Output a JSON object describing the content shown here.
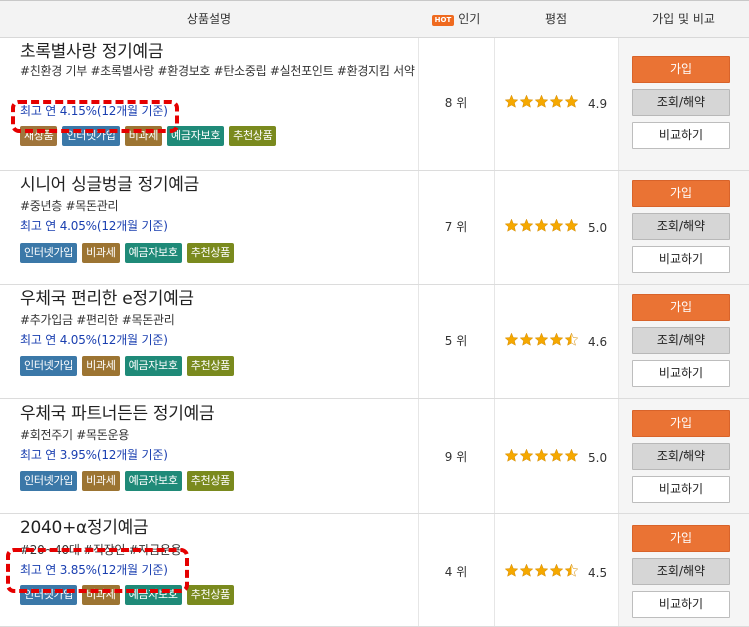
{
  "header": {
    "description": "상품설명",
    "hot": "HOT",
    "popularity": "인기",
    "rating": "평점",
    "actions": "가입 및 비교"
  },
  "colors": {
    "accent": "#ea7334",
    "rate_text": "#1a3fb0",
    "star": "#f5a800",
    "highlight": "#e50000"
  },
  "products": [
    {
      "name": "초록별사랑 정기예금",
      "tags": "#친환경 기부 #초록별사랑 #환경보호 #탄소중립 #실천포인트 #환경지킴 서약",
      "rate": "최고 연 4.15%(12개월 기준)",
      "badges": [
        "새상품",
        "인터넷가입",
        "비과세",
        "예금자보호",
        "추천상품"
      ],
      "rank": "8 위",
      "stars": 5,
      "score": "4.9",
      "join": "가입",
      "inquiry": "조회/해약",
      "compare": "비교하기"
    },
    {
      "name": "시니어 싱글벙글 정기예금",
      "tags": "#중년층 #목돈관리",
      "rate": "최고 연 4.05%(12개월 기준)",
      "badges": [
        "인터넷가입",
        "비과세",
        "예금자보호",
        "추천상품"
      ],
      "rank": "7 위",
      "stars": 5,
      "score": "5.0",
      "join": "가입",
      "inquiry": "조회/해약",
      "compare": "비교하기"
    },
    {
      "name": "우체국 편리한 e정기예금",
      "tags": "#추가입금 #편리한 #목돈관리",
      "rate": "최고 연 4.05%(12개월 기준)",
      "badges": [
        "인터넷가입",
        "비과세",
        "예금자보호",
        "추천상품"
      ],
      "rank": "5 위",
      "stars": 4.5,
      "score": "4.6",
      "join": "가입",
      "inquiry": "조회/해약",
      "compare": "비교하기"
    },
    {
      "name": "우체국 파트너든든 정기예금",
      "tags": "#회전주기 #목돈운용",
      "rate": "최고 연 3.95%(12개월 기준)",
      "badges": [
        "인터넷가입",
        "비과세",
        "예금자보호",
        "추천상품"
      ],
      "rank": "9 위",
      "stars": 5,
      "score": "5.0",
      "join": "가입",
      "inquiry": "조회/해약",
      "compare": "비교하기"
    },
    {
      "name": "2040+α정기예금",
      "tags": "#20~40대 #직장인 #자금운용",
      "rate": "최고 연 3.85%(12개월 기준)",
      "badges": [
        "인터넷가입",
        "비과세",
        "예금자보호",
        "추천상품"
      ],
      "rank": "4 위",
      "stars": 4.5,
      "score": "4.5",
      "join": "가입",
      "inquiry": "조회/해약",
      "compare": "비교하기"
    }
  ],
  "badge_colors": {
    "새상품": "#a0753b",
    "인터넷가입": "#3b78a8",
    "비과세": "#9c7432",
    "예금자보호": "#1f8a78",
    "추천상품": "#7a8a1e"
  }
}
